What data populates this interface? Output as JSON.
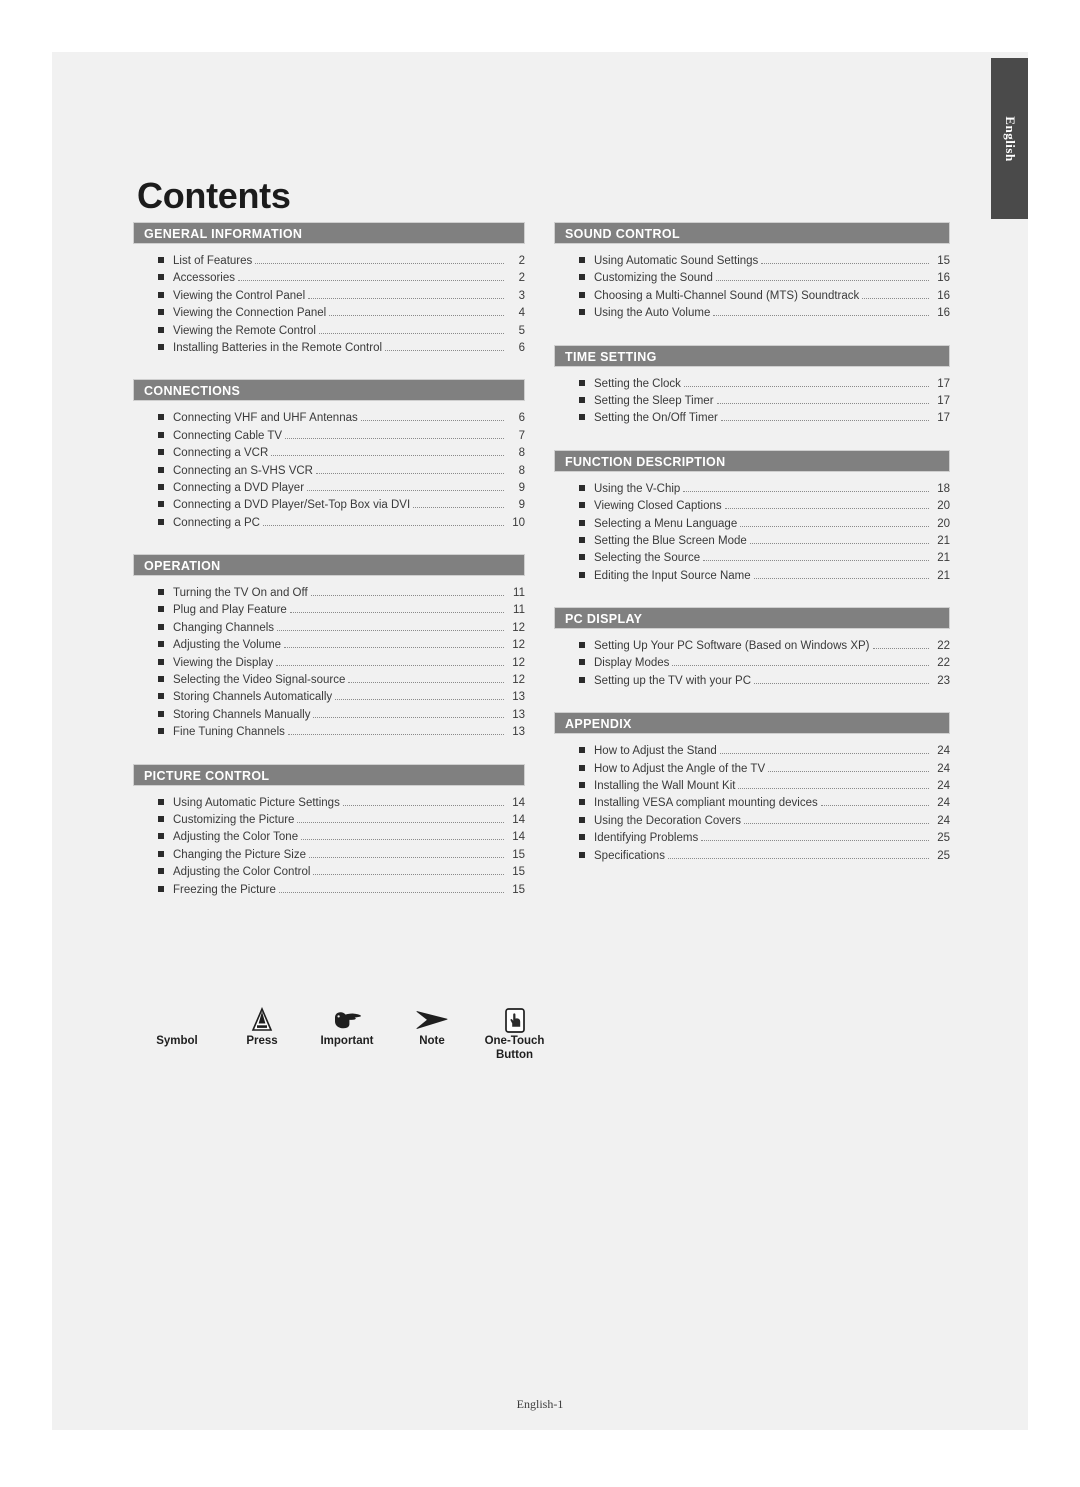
{
  "page": {
    "title": "Contents",
    "side_tab_label": "English",
    "footer": "English-1"
  },
  "columns": {
    "left": [
      {
        "header": "GENERAL INFORMATION",
        "items": [
          {
            "label": "List of Features",
            "page": "2"
          },
          {
            "label": "Accessories",
            "page": "2"
          },
          {
            "label": "Viewing the Control Panel",
            "page": "3"
          },
          {
            "label": "Viewing the Connection Panel",
            "page": "4"
          },
          {
            "label": "Viewing the Remote Control",
            "page": "5"
          },
          {
            "label": "Installing Batteries in the Remote Control",
            "page": "6"
          }
        ]
      },
      {
        "header": "CONNECTIONS",
        "items": [
          {
            "label": "Connecting VHF and UHF Antennas",
            "page": "6"
          },
          {
            "label": "Connecting Cable TV",
            "page": "7"
          },
          {
            "label": "Connecting a VCR",
            "page": "8"
          },
          {
            "label": "Connecting an S-VHS VCR",
            "page": "8"
          },
          {
            "label": "Connecting a DVD Player",
            "page": "9"
          },
          {
            "label": "Connecting a DVD Player/Set-Top Box via DVI",
            "page": "9"
          },
          {
            "label": "Connecting a PC",
            "page": "10"
          }
        ]
      },
      {
        "header": "OPERATION",
        "items": [
          {
            "label": "Turning the TV On and Off",
            "page": "11"
          },
          {
            "label": "Plug and Play Feature",
            "page": "11"
          },
          {
            "label": "Changing Channels",
            "page": "12"
          },
          {
            "label": "Adjusting the Volume",
            "page": "12"
          },
          {
            "label": "Viewing the Display",
            "page": "12"
          },
          {
            "label": "Selecting the Video Signal-source",
            "page": "12"
          },
          {
            "label": "Storing Channels Automatically",
            "page": "13"
          },
          {
            "label": "Storing Channels Manually",
            "page": "13"
          },
          {
            "label": "Fine Tuning Channels",
            "page": "13"
          }
        ]
      },
      {
        "header": "PICTURE CONTROL",
        "items": [
          {
            "label": "Using Automatic Picture Settings",
            "page": "14"
          },
          {
            "label": "Customizing the Picture",
            "page": "14"
          },
          {
            "label": "Adjusting the Color Tone",
            "page": "14"
          },
          {
            "label": "Changing the Picture Size",
            "page": "15"
          },
          {
            "label": "Adjusting the Color Control",
            "page": "15"
          },
          {
            "label": "Freezing the Picture",
            "page": "15"
          }
        ]
      }
    ],
    "right": [
      {
        "header": "SOUND CONTROL",
        "items": [
          {
            "label": "Using Automatic Sound Settings",
            "page": "15"
          },
          {
            "label": "Customizing the Sound",
            "page": "16"
          },
          {
            "label": "Choosing a Multi-Channel Sound (MTS) Soundtrack",
            "page": "16"
          },
          {
            "label": "Using the Auto Volume",
            "page": "16"
          }
        ]
      },
      {
        "header": "TIME SETTING",
        "items": [
          {
            "label": "Setting the Clock",
            "page": "17"
          },
          {
            "label": "Setting the Sleep Timer",
            "page": "17"
          },
          {
            "label": "Setting the On/Off Timer",
            "page": "17"
          }
        ]
      },
      {
        "header": "FUNCTION DESCRIPTION",
        "items": [
          {
            "label": "Using the V-Chip",
            "page": "18"
          },
          {
            "label": "Viewing Closed Captions",
            "page": "20"
          },
          {
            "label": "Selecting a Menu Language",
            "page": "20"
          },
          {
            "label": "Setting the Blue Screen Mode",
            "page": "21"
          },
          {
            "label": "Selecting the Source",
            "page": "21"
          },
          {
            "label": "Editing the Input Source Name",
            "page": "21"
          }
        ]
      },
      {
        "header": "PC DISPLAY",
        "items": [
          {
            "label": "Setting Up Your PC Software (Based on Windows XP)",
            "page": "22"
          },
          {
            "label": "Display Modes",
            "page": "22"
          },
          {
            "label": "Setting up the TV with your PC",
            "page": "23"
          }
        ]
      },
      {
        "header": "APPENDIX",
        "items": [
          {
            "label": "How to Adjust the Stand",
            "page": "24"
          },
          {
            "label": "How to Adjust the Angle of the TV",
            "page": "24"
          },
          {
            "label": "Installing the Wall Mount Kit",
            "page": "24"
          },
          {
            "label": "Installing VESA compliant mounting devices",
            "page": "24"
          },
          {
            "label": "Using the Decoration Covers",
            "page": "24"
          },
          {
            "label": "Identifying Problems",
            "page": "25"
          },
          {
            "label": "Specifications",
            "page": "25"
          }
        ]
      }
    ]
  },
  "legend": [
    {
      "label": "Symbol",
      "icon": "none"
    },
    {
      "label": "Press",
      "icon": "press-triangle-icon"
    },
    {
      "label": "Important",
      "icon": "pointing-hand-icon"
    },
    {
      "label": "Note",
      "icon": "note-arrow-icon"
    },
    {
      "label": "One-Touch\nButton",
      "icon": "one-touch-button-icon"
    }
  ],
  "colors": {
    "section_header_bg": "#808080",
    "page_bg": "#f1f1f1",
    "tab_bg": "#4a4a4a",
    "text": "#3a3a3a"
  }
}
